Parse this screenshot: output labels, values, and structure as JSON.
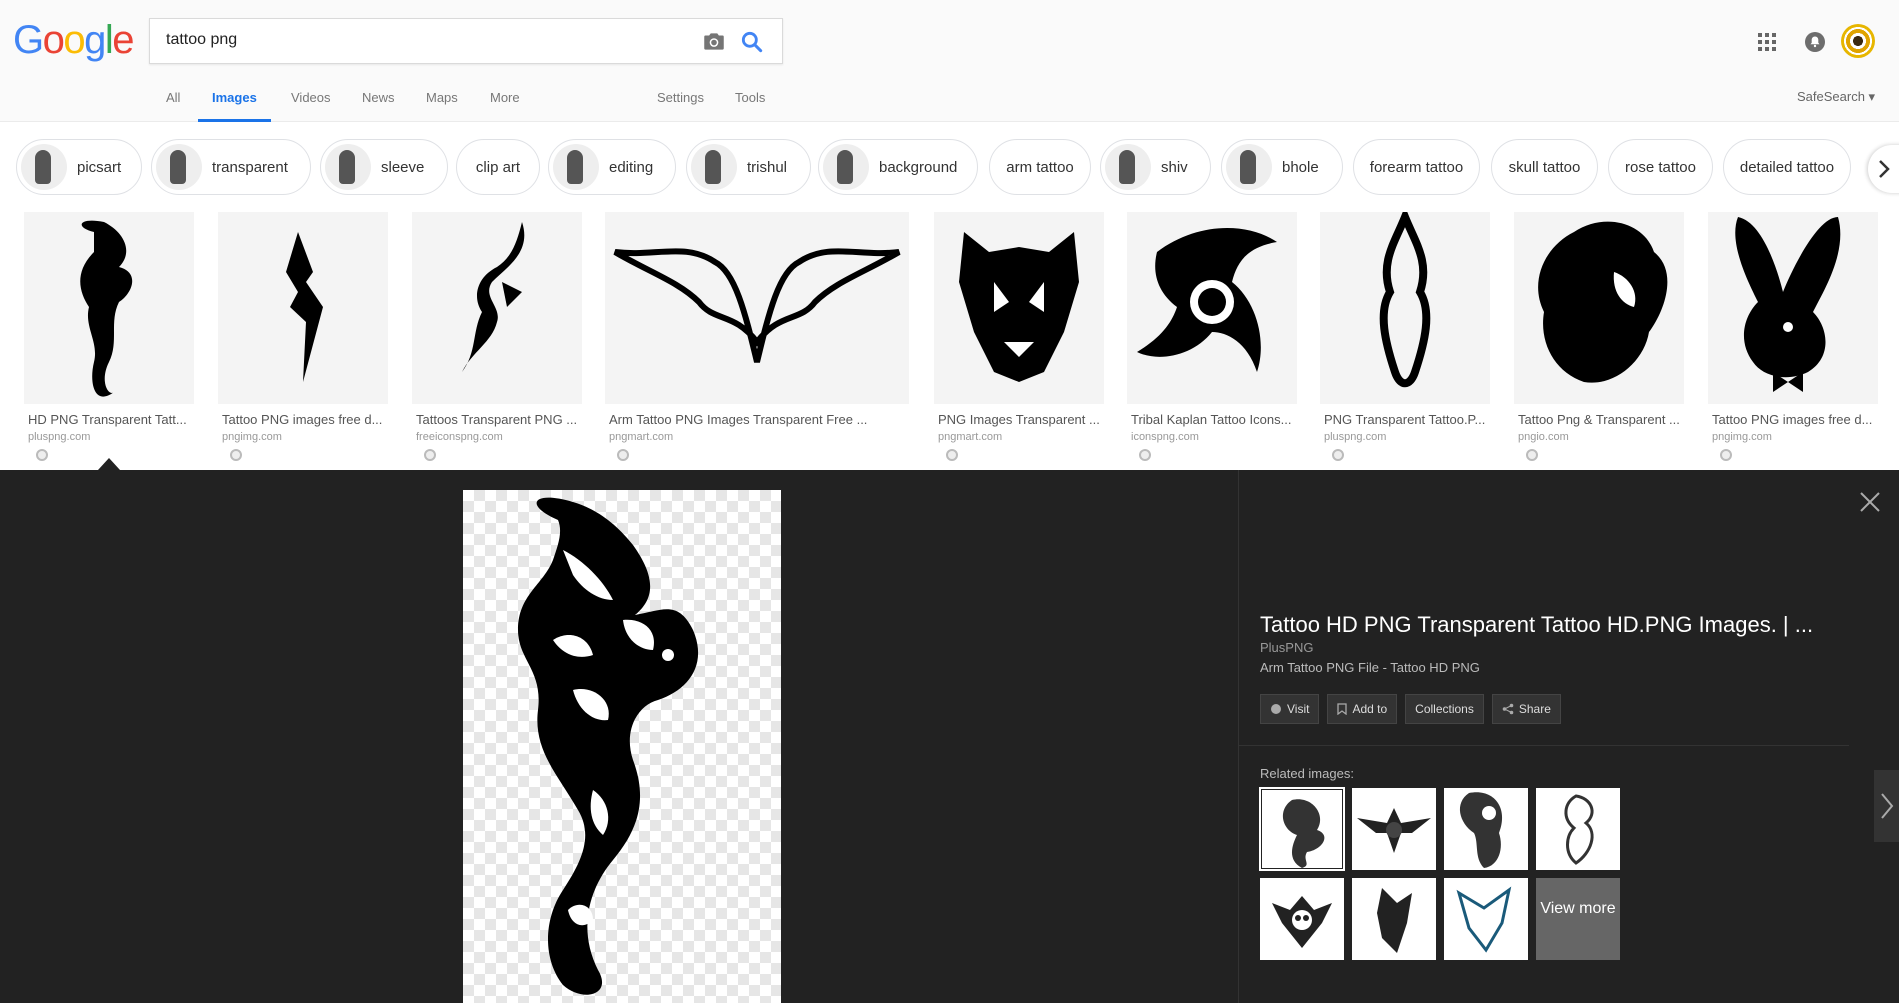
{
  "header": {
    "logo": [
      "G",
      "o",
      "o",
      "g",
      "l",
      "e"
    ],
    "logo_colors": [
      "#4285F4",
      "#EA4335",
      "#FBBC05",
      "#4285F4",
      "#34A853",
      "#EA4335"
    ],
    "search_value": "tattoo png",
    "camera_icon": "camera-icon",
    "search_icon": "search-icon"
  },
  "tabs": {
    "all": "All",
    "images": "Images",
    "videos": "Videos",
    "news": "News",
    "maps": "Maps",
    "more": "More",
    "settings": "Settings",
    "tools": "Tools",
    "safesearch": "SafeSearch"
  },
  "chips": [
    {
      "label": "picsart",
      "thumb": true
    },
    {
      "label": "transparent",
      "thumb": true
    },
    {
      "label": "sleeve",
      "thumb": true
    },
    {
      "label": "clip art",
      "thumb": false
    },
    {
      "label": "editing",
      "thumb": true
    },
    {
      "label": "trishul",
      "thumb": true
    },
    {
      "label": "background",
      "thumb": true
    },
    {
      "label": "arm tattoo",
      "thumb": false
    },
    {
      "label": "shiv",
      "thumb": true
    },
    {
      "label": "bhole",
      "thumb": true
    },
    {
      "label": "forearm tattoo",
      "thumb": false
    },
    {
      "label": "skull tattoo",
      "thumb": false
    },
    {
      "label": "rose tattoo",
      "thumb": false
    },
    {
      "label": "detailed tattoo",
      "thumb": false
    }
  ],
  "results": [
    {
      "title": "HD PNG Transparent Tatt...",
      "domain": "pluspng.com",
      "shape": "dragon"
    },
    {
      "title": "Tattoo PNG images free d...",
      "domain": "pngimg.com",
      "shape": "blade"
    },
    {
      "title": "Tattoos Transparent PNG ...",
      "domain": "freeiconspng.com",
      "shape": "tribal"
    },
    {
      "title": "Arm Tattoo PNG Images Transparent Free ...",
      "domain": "pngmart.com",
      "shape": "wings"
    },
    {
      "title": "PNG Images Transparent ...",
      "domain": "pngmart.com",
      "shape": "tiger"
    },
    {
      "title": "Tribal Kaplan Tattoo Icons...",
      "domain": "iconspng.com",
      "shape": "shuriken"
    },
    {
      "title": "PNG Transparent Tattoo.P...",
      "domain": "pluspng.com",
      "shape": "totem"
    },
    {
      "title": "Tattoo Png & Transparent ...",
      "domain": "pngio.com",
      "shape": "lion"
    },
    {
      "title": "Tattoo PNG images free d...",
      "domain": "pngimg.com",
      "shape": "bunny"
    }
  ],
  "preview": {
    "title": "Tattoo HD PNG Transparent Tattoo HD.PNG Images. | ...",
    "source": "PlusPNG",
    "description": "Arm Tattoo PNG File - Tattoo HD PNG",
    "actions": {
      "visit": "Visit",
      "add_to": "Add to",
      "collections": "Collections",
      "share": "Share"
    },
    "related_label": "Related images:",
    "view_more": "View more"
  }
}
